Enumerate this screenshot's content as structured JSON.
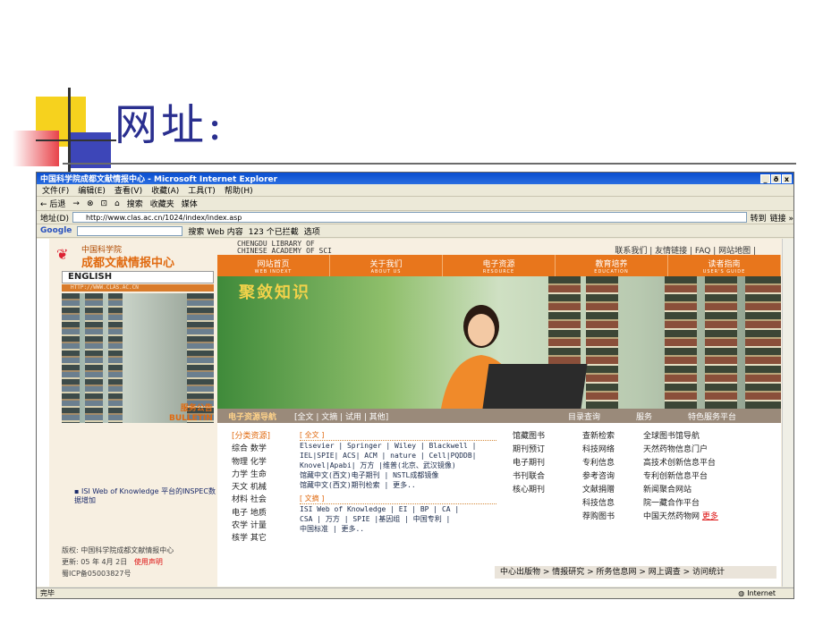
{
  "slide": {
    "title": "网址:"
  },
  "browser": {
    "title": "中国科学院成都文献情报中心 - Microsoft Internet Explorer",
    "window_buttons": [
      "_",
      "ð",
      "x"
    ],
    "menu": [
      "文件(F)",
      "编辑(E)",
      "查看(V)",
      "收藏(A)",
      "工具(T)",
      "帮助(H)"
    ],
    "toolbar": [
      "← 后退",
      "→",
      "⊗",
      "⊡",
      "⌂",
      "搜索",
      "收藏夹",
      "媒体"
    ],
    "address_label": "地址(D)",
    "address_value": "http://www.clas.ac.cn/1024/index/index.asp",
    "go_label": "转到",
    "links_label": "链接 »",
    "google_label": "Google",
    "google_search": "搜索 Web 内容",
    "google_blocked": "123 个已拦截",
    "google_options": "选项",
    "status_left": "完毕",
    "status_zone": "Internet"
  },
  "site": {
    "logo_top": "中国科学院",
    "logo_main": "成都文献情报中心",
    "en_line1": "CHENGDU LIBRARY OF",
    "en_line2": "CHINESE ACADEMY OF SCI",
    "top_links": "联系我们 | 友情链接 | FAQ | 网站地图 |",
    "english": "ENGLISH",
    "url_strip": "HTTP://WWW.CLAS.AC.CN",
    "nav": [
      {
        "cn": "网站首页",
        "en": "WEB INDEXT"
      },
      {
        "cn": "关于我们",
        "en": "ABOUT US"
      },
      {
        "cn": "电子资源",
        "en": "RESOURCE"
      },
      {
        "cn": "教育培养",
        "en": "EDUCATION"
      },
      {
        "cn": "读者指南",
        "en": "USER'S GUIDE"
      }
    ],
    "banner_title": "聚敛知识",
    "bulletin_cn": "服务公告",
    "bulletin_en": "BULLETIN",
    "res_nav_title": "电子资源导航",
    "res_nav_links": "[全文 | 文摘 | 试用 | 其他]",
    "res_bar_items": [
      "目录查询",
      "服务",
      "特色服务平台"
    ],
    "categories_title": "[分类资源]",
    "categories": [
      "综合 数学",
      "物理 化学",
      "力学 生命",
      "天文 机械",
      "材料 社会",
      "电子 地质",
      "农学 计量",
      "核学 其它"
    ],
    "fulltext_title": "[ 全文 ]",
    "fulltext": [
      "Elsevier | Springer | Wiley | Blackwell |",
      "IEL|SPIE| ACS| ACM | nature | Cell|PQDDB|",
      "Knovel|Apabi| 万方 |维普(北京、武汉镜像)",
      "馆藏中文(西文)电子期刊 | NSTL成都镜像",
      "馆藏中文(西文)期刊检索 | 更多.."
    ],
    "abstract_title": "[ 文摘 ]",
    "abstract": [
      "ISI Web of Knowledge | EI | BP | CA |",
      "CSA | 万方 | SPIE |基因组 | 中国专利 |",
      "中国标准 | 更多.."
    ],
    "col1": [
      "馆藏图书",
      "期刊预订",
      "电子期刊",
      "书刊联合",
      "核心期刊"
    ],
    "col2": [
      "查新检索",
      "科技网络",
      "专利信息",
      "参考咨询",
      "文献捐赠",
      "科技信息",
      "荐购图书"
    ],
    "col3": [
      "全球图书馆导航",
      "天然药物信息门户",
      "高技术创新信息平台",
      "专利创新信息平台",
      "新闻聚合网站",
      "院一藏合作平台",
      "中国天然药物网"
    ],
    "col3_more": "更多",
    "isi_news": "ISI Web of Knowledge 平台的INSPEC数据增加",
    "footer_links": "中心出版物 > 情报研究 > 所务信息网 > 网上调查 > 访问统计",
    "copyright": "版权: 中国科学院成都文献情报中心",
    "updated": "更新: 05 年 4月 2日",
    "usage": "使用声明",
    "icp": "蜀ICP备05003827号"
  }
}
